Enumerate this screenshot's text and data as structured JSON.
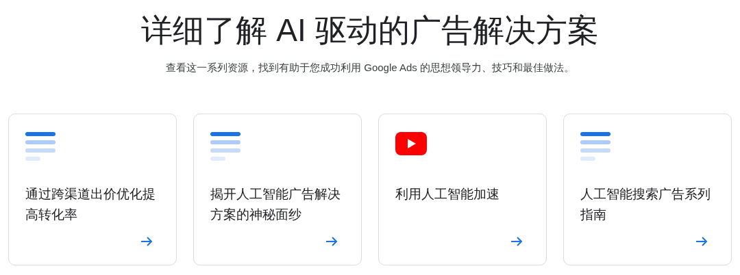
{
  "heading": "详细了解 AI 驱动的广告解决方案",
  "subtitle": "查看这一系列资源，找到有助于您成功利用 Google Ads 的思想领导力、技巧和最佳做法。",
  "cards": [
    {
      "kind": "document",
      "title": "通过跨渠道出价优化提高转化率"
    },
    {
      "kind": "document",
      "title": "揭开人工智能广告解决方案的神秘面纱"
    },
    {
      "kind": "video",
      "title": "利用人工智能加速"
    },
    {
      "kind": "document",
      "title": "人工智能搜索广告系列指南"
    }
  ]
}
